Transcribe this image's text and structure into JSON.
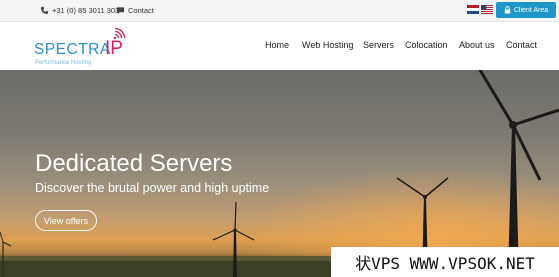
{
  "topbar": {
    "phone": "+31 (0) 85 3011 303",
    "contact": "Contact",
    "client_area": "Client Area"
  },
  "logo": {
    "word": "SPECTRA",
    "ip": "IP",
    "tagline": "Performance Hosting"
  },
  "nav": {
    "items": [
      "Home",
      "Web Hosting",
      "Servers",
      "Colocation",
      "About us",
      "Contact"
    ]
  },
  "hero": {
    "title": "Dedicated Servers",
    "subtitle": "Discover the brutal power and high uptime",
    "button": "View offers"
  },
  "watermark": "状VPS WWW.VPSOK.NET",
  "colors": {
    "brand_blue": "#2a91c7",
    "brand_pink": "#d61f5c",
    "button_blue": "#1e96c8"
  },
  "icons": {
    "phone": "phone-icon",
    "contact": "message-icon",
    "client_area": "lock-icon",
    "flags": [
      "flag-nl-icon",
      "flag-us-icon"
    ]
  }
}
